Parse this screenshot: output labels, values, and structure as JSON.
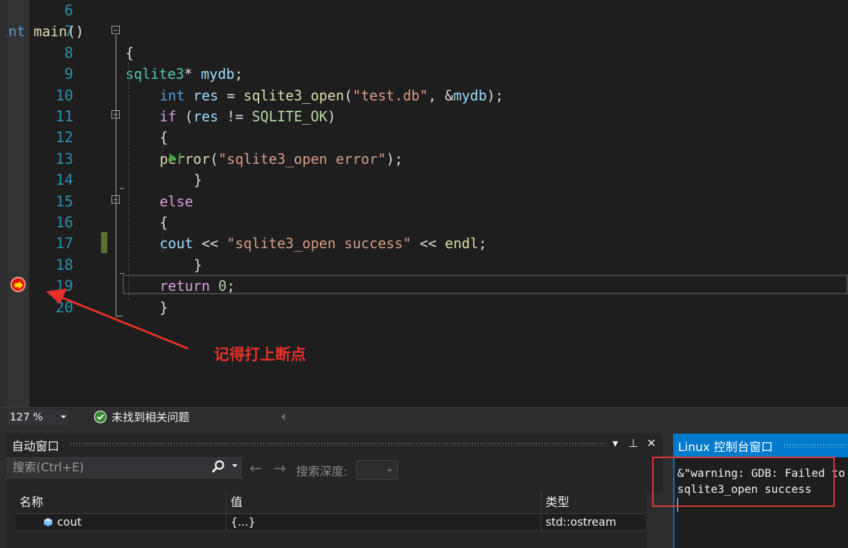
{
  "editor": {
    "lines": [
      {
        "num": "6"
      },
      {
        "num": "7",
        "tokens": [
          {
            "c": "kw",
            "t": "int"
          },
          {
            "c": "pl",
            "t": " "
          },
          {
            "c": "fn",
            "t": "main"
          },
          {
            "c": "pl",
            "t": "()"
          }
        ]
      },
      {
        "num": "8",
        "tokens": [
          {
            "c": "pl",
            "t": "{"
          }
        ]
      },
      {
        "num": "9",
        "tokens": [
          {
            "c": "ty",
            "t": "sqlite3"
          },
          {
            "c": "pl",
            "t": "* "
          },
          {
            "c": "va",
            "t": "mydb"
          },
          {
            "c": "pl",
            "t": ";"
          }
        ]
      },
      {
        "num": "10",
        "tokens": [
          {
            "c": "kw",
            "t": "int"
          },
          {
            "c": "pl",
            "t": " "
          },
          {
            "c": "va",
            "t": "res"
          },
          {
            "c": "pl",
            "t": " = "
          },
          {
            "c": "fn",
            "t": "sqlite3_open"
          },
          {
            "c": "pl",
            "t": "("
          },
          {
            "c": "st",
            "t": "\"test.db\""
          },
          {
            "c": "pl",
            "t": ", &"
          },
          {
            "c": "va",
            "t": "mydb"
          },
          {
            "c": "pl",
            "t": ");"
          }
        ]
      },
      {
        "num": "11",
        "tokens": [
          {
            "c": "kwc",
            "t": "if"
          },
          {
            "c": "pl",
            "t": " ("
          },
          {
            "c": "va",
            "t": "res"
          },
          {
            "c": "pl",
            "t": " != "
          },
          {
            "c": "mc",
            "t": "SQLITE_OK"
          },
          {
            "c": "pl",
            "t": ")"
          }
        ]
      },
      {
        "num": "12",
        "tokens": [
          {
            "c": "pl",
            "t": "{"
          }
        ]
      },
      {
        "num": "13",
        "tokens": [
          {
            "c": "fn",
            "t": "perror"
          },
          {
            "c": "pl",
            "t": "("
          },
          {
            "c": "st",
            "t": "\"sqlite3_open error\""
          },
          {
            "c": "pl",
            "t": ");"
          }
        ]
      },
      {
        "num": "14",
        "tokens": [
          {
            "c": "pl",
            "t": "}"
          }
        ]
      },
      {
        "num": "15",
        "tokens": [
          {
            "c": "kwc",
            "t": "else"
          }
        ]
      },
      {
        "num": "16",
        "tokens": [
          {
            "c": "pl",
            "t": "{"
          }
        ]
      },
      {
        "num": "17",
        "tokens": [
          {
            "c": "va",
            "t": "cout"
          },
          {
            "c": "pl",
            "t": " << "
          },
          {
            "c": "st",
            "t": "\"sqlite3_open success\""
          },
          {
            "c": "pl",
            "t": " << "
          },
          {
            "c": "fn",
            "t": "endl"
          },
          {
            "c": "pl",
            "t": ";"
          }
        ]
      },
      {
        "num": "18",
        "tokens": [
          {
            "c": "pl",
            "t": "}"
          }
        ]
      },
      {
        "num": "19",
        "tokens": [
          {
            "c": "kwc",
            "t": "return"
          },
          {
            "c": "pl",
            "t": " "
          },
          {
            "c": "nu",
            "t": "0"
          },
          {
            "c": "pl",
            "t": ";"
          }
        ]
      },
      {
        "num": "20",
        "tokens": [
          {
            "c": "pl",
            "t": "}"
          }
        ]
      }
    ],
    "annotation": "记得打上断点"
  },
  "status": {
    "zoom": "127 %",
    "issues": "未找到相关问题"
  },
  "autos": {
    "title": "自动窗口",
    "search_placeholder": "搜索(Ctrl+E)",
    "depth_label": "搜索深度:",
    "columns": {
      "name": "名称",
      "value": "值",
      "type": "类型"
    },
    "rows": [
      {
        "name": "cout",
        "value": "{...}",
        "type": "std::ostream"
      }
    ],
    "buttons": {
      "dropdown": "▾",
      "pin": "⊥",
      "close": "✕"
    }
  },
  "console": {
    "title": "Linux 控制台窗口",
    "lines": [
      "&\"warning: GDB: Failed to",
      "sqlite3_open success"
    ]
  },
  "colors": {
    "accent": "#007acc",
    "annotation": "#e8302a",
    "breakpoint": "#e51400"
  }
}
